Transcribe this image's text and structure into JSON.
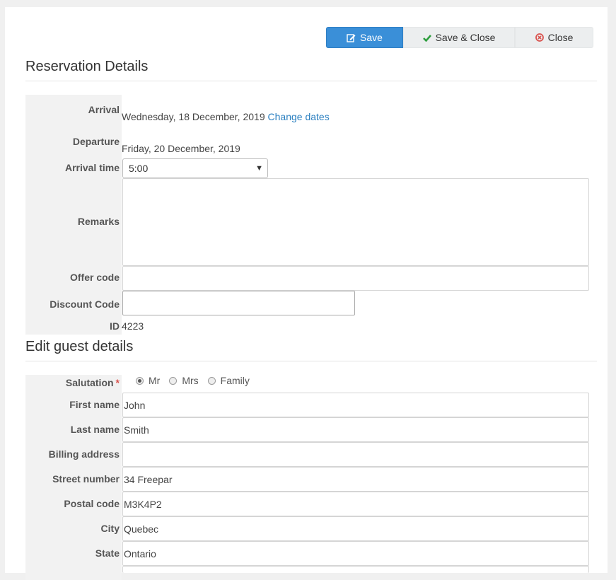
{
  "toolbar": {
    "save_label": "Save",
    "save_close_label": "Save & Close",
    "close_label": "Close",
    "colors": {
      "primary": "#3a8fd8",
      "success": "#2e9e3e",
      "danger": "#d9534f"
    }
  },
  "reservation": {
    "title": "Reservation Details",
    "arrival_label": "Arrival",
    "arrival_value": "Wednesday, 18 December, 2019",
    "change_dates_link": "Change dates",
    "departure_label": "Departure",
    "departure_value": "Friday, 20 December, 2019",
    "arrival_time_label": "Arrival time",
    "arrival_time_value": "5:00",
    "remarks_label": "Remarks",
    "remarks_value": "",
    "offer_code_label": "Offer code",
    "offer_code_value": "",
    "discount_code_label": "Discount Code",
    "discount_code_value": "",
    "id_label": "ID",
    "id_value": "4223"
  },
  "guest": {
    "title": "Edit guest details",
    "salutation_label": "Salutation",
    "required_mark": "*",
    "salutation_options": [
      "Mr",
      "Mrs",
      "Family"
    ],
    "salutation_selected": "Mr",
    "first_name_label": "First name",
    "first_name_value": "John",
    "last_name_label": "Last name",
    "last_name_value": "Smith",
    "billing_address_label": "Billing address",
    "billing_address_value": "",
    "street_number_label": "Street number",
    "street_number_value": "34 Freepar",
    "postal_code_label": "Postal code",
    "postal_code_value": "M3K4P2",
    "city_label": "City",
    "city_value": "Quebec",
    "state_label": "State",
    "state_value": "Ontario"
  }
}
